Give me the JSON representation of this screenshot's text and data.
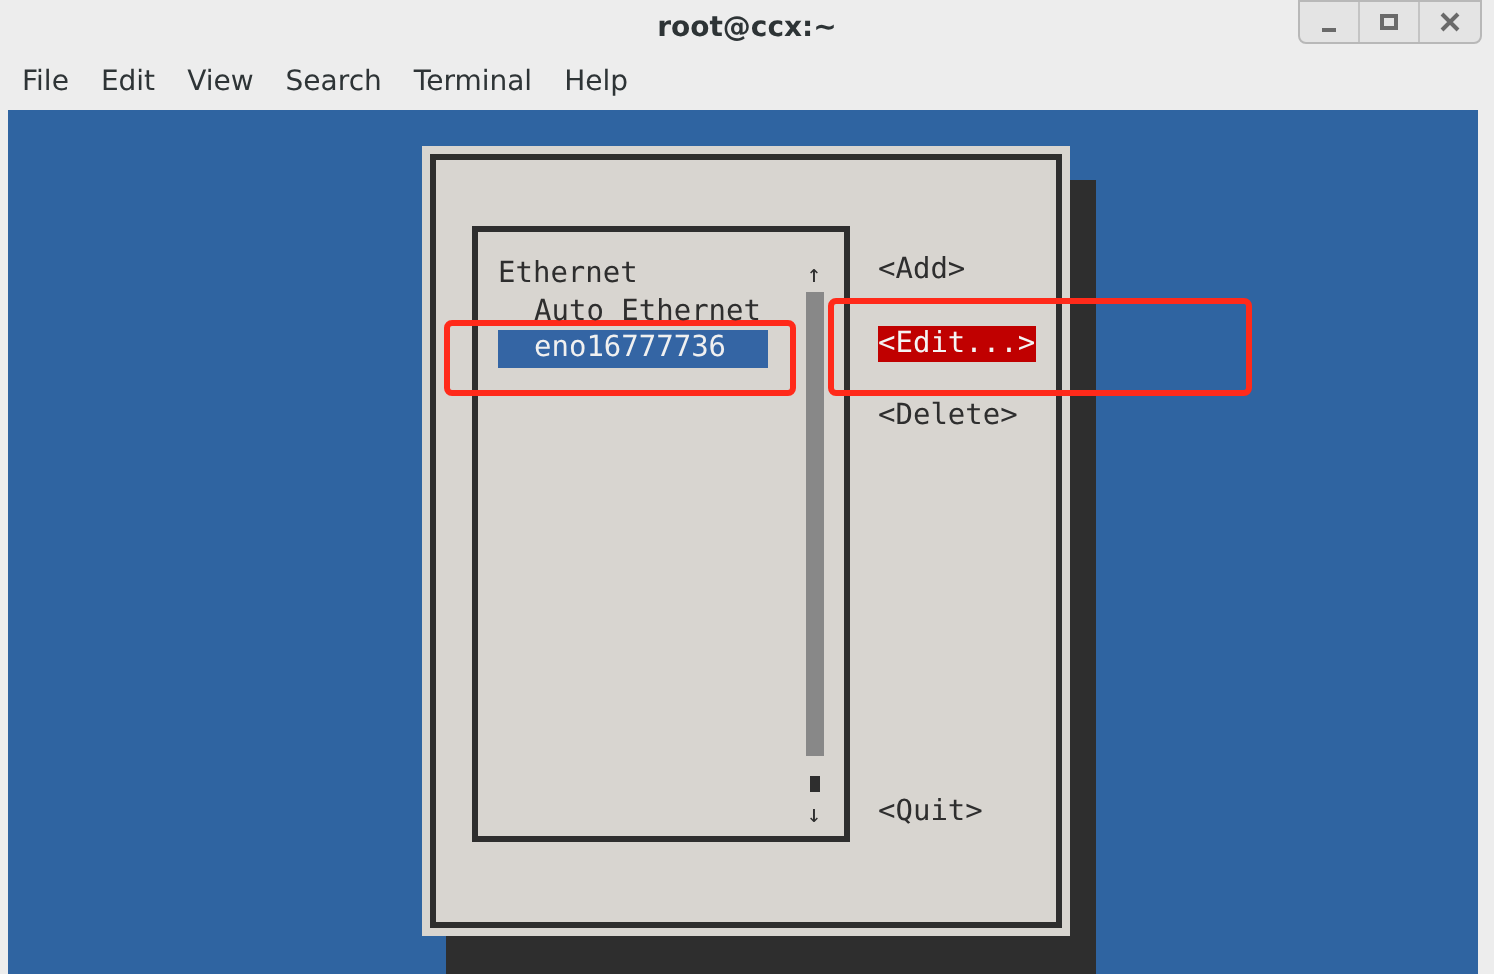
{
  "window": {
    "title": "root@ccx:~"
  },
  "menu": [
    "File",
    "Edit",
    "View",
    "Search",
    "Terminal",
    "Help"
  ],
  "list": {
    "scroll_up": "↑",
    "scroll_down": "↓",
    "items": [
      {
        "label": "Ethernet",
        "selected": false,
        "children": [
          {
            "label": "Auto Ethernet",
            "selected": false
          },
          {
            "label": "eno16777736",
            "selected": true
          }
        ]
      }
    ]
  },
  "buttons": [
    {
      "label": "<Add>",
      "selected": false
    },
    {
      "label": "<Edit...>",
      "selected": true
    },
    {
      "label": "<Delete>",
      "selected": false
    },
    {
      "label": "<Quit>",
      "selected": false
    }
  ]
}
